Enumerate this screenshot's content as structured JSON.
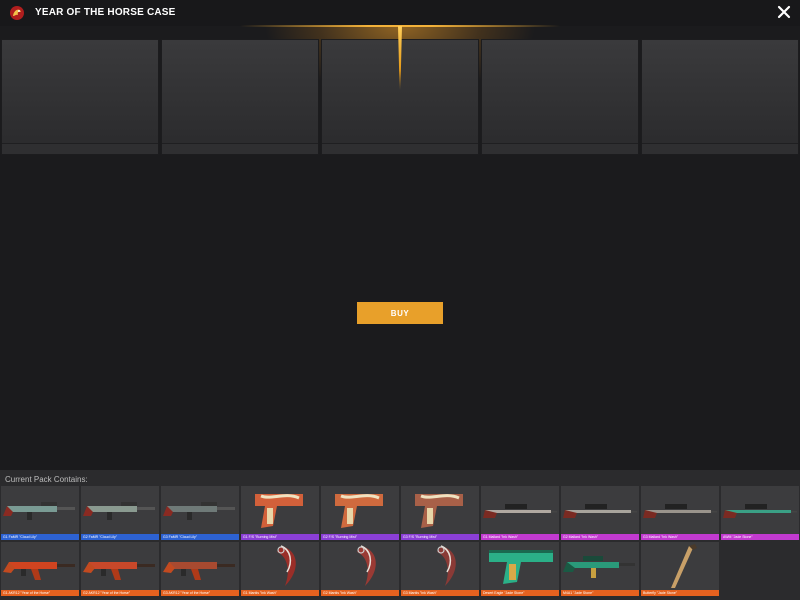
{
  "header": {
    "title": "YEAR OF THE HORSE CASE",
    "logo_icon": "dragon-logo-icon",
    "close_icon": "close-icon"
  },
  "reel": {
    "slot_count": 5
  },
  "buy": {
    "label": "BUY"
  },
  "contains": {
    "label": "Current Pack Contains:",
    "items": [
      {
        "name": "G1 FaMR \"Cloud Lily\"",
        "rarity_color": "#2d62d2",
        "kind": "rifle",
        "tint": "#7a9b94"
      },
      {
        "name": "G2 FaMR \"Cloud Lily\"",
        "rarity_color": "#2d62d2",
        "kind": "rifle",
        "tint": "#8a9a90"
      },
      {
        "name": "G3 FaMR \"Cloud Lily\"",
        "rarity_color": "#2d62d2",
        "kind": "rifle",
        "tint": "#6f7a78"
      },
      {
        "name": "G1 F/S \"Burning Mist\"",
        "rarity_color": "#8b3fd6",
        "kind": "pistol",
        "tint": "#d2603a"
      },
      {
        "name": "G2 F/S \"Burning Mist\"",
        "rarity_color": "#8b3fd6",
        "kind": "pistol",
        "tint": "#cf6a3e"
      },
      {
        "name": "G3 F/S \"Burning Mist\"",
        "rarity_color": "#8b3fd6",
        "kind": "pistol",
        "tint": "#a86048"
      },
      {
        "name": "G1 Mallard \"Ink Wash\"",
        "rarity_color": "#c23ad0",
        "kind": "sniper",
        "tint": "#b0a8a0"
      },
      {
        "name": "G2 Mallard \"Ink Wash\"",
        "rarity_color": "#c23ad0",
        "kind": "sniper",
        "tint": "#a8a49c"
      },
      {
        "name": "G3 Mallard \"Ink Wash\"",
        "rarity_color": "#c23ad0",
        "kind": "sniper",
        "tint": "#9a948c"
      },
      {
        "name": "AWM \"Jade Stone\"",
        "rarity_color": "#c23ad0",
        "kind": "sniper",
        "tint": "#3aa085"
      },
      {
        "name": "G1 AKR12 \"Year of the Horse\"",
        "rarity_color": "#e5611f",
        "kind": "ak",
        "tint": "#d04420"
      },
      {
        "name": "G2 AKR12 \"Year of the Horse\"",
        "rarity_color": "#e5611f",
        "kind": "ak",
        "tint": "#c8482a"
      },
      {
        "name": "G3 AKR12 \"Year of the Horse\"",
        "rarity_color": "#e5611f",
        "kind": "ak",
        "tint": "#a84a30"
      },
      {
        "name": "G1 Mantis \"Ink Wash\"",
        "rarity_color": "#e5611f",
        "kind": "knife",
        "tint": "#9a2e28"
      },
      {
        "name": "G2 Mantis \"Ink Wash\"",
        "rarity_color": "#e5611f",
        "kind": "knife",
        "tint": "#9a3a34"
      },
      {
        "name": "G3 Mantis \"Ink Wash\"",
        "rarity_color": "#e5611f",
        "kind": "knife",
        "tint": "#8a3a36"
      },
      {
        "name": "Desert Eagle \"Jade Stone\"",
        "rarity_color": "#e5611f",
        "kind": "deagle",
        "tint": "#2bb088"
      },
      {
        "name": "M4A1 \"Jade Stone\"",
        "rarity_color": "#e5611f",
        "kind": "m4",
        "tint": "#2a9a7a"
      },
      {
        "name": "Butterfly \"Jade Stone\"",
        "rarity_color": "#e5611f",
        "kind": "butterfly",
        "tint": "#c8a068"
      }
    ]
  },
  "colors": {
    "accent": "#e8a02a",
    "background": "#1b1b1d",
    "panel": "#2b2b2d"
  }
}
